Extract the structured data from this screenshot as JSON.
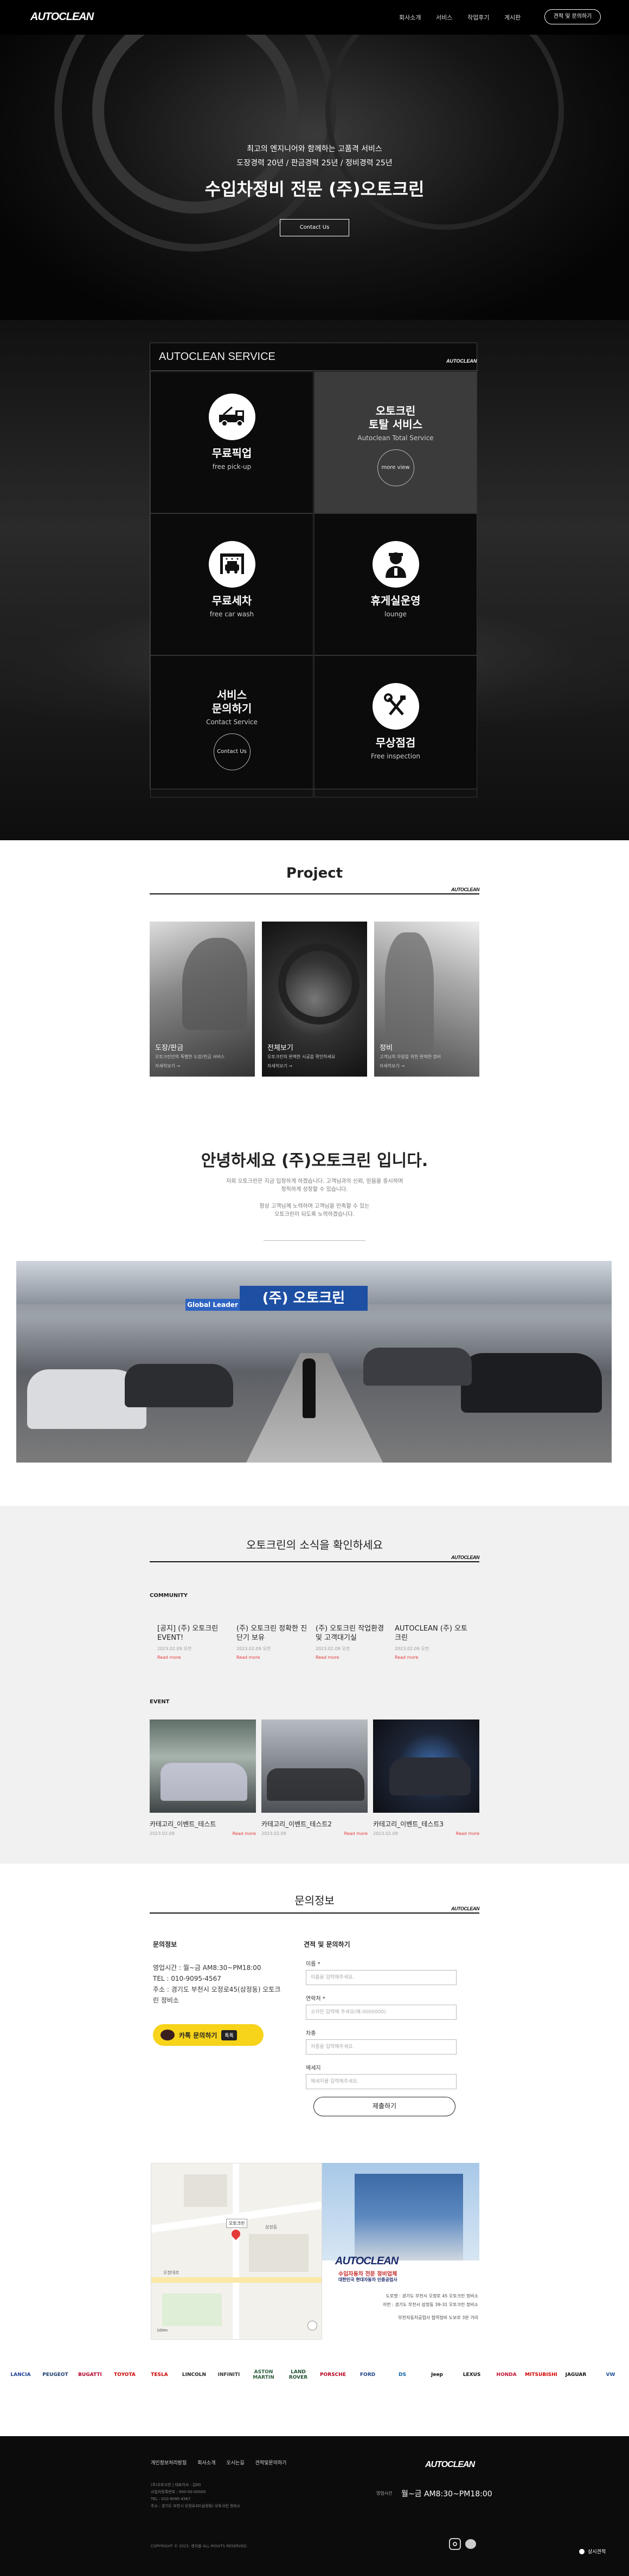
{
  "header": {
    "logo": "AUTOCLEAN",
    "nav": [
      "회사소개",
      "서비스",
      "작업후기",
      "게시판"
    ],
    "cta": "견적 및 문의하기"
  },
  "hero": {
    "line1": "최고의 엔지니어와 함께하는 고품격 서비스",
    "line2": "도장경력 20년 / 판금경력 25년 / 정비경력 25년",
    "title": "수입차정비 전문 (주)오토크린",
    "button": "Contact Us"
  },
  "services": {
    "title": "AUTOCLEAN SERVICE",
    "logo": "AUTOCLEAN",
    "cells": [
      {
        "title": "무료픽업",
        "sub": "free pick-up",
        "icon": "tow-truck-icon"
      },
      {
        "title_line1": "오토크린",
        "title_line2": "토탈 서비스",
        "sub": "Autoclean Total Service",
        "button": "more view"
      },
      {
        "title": "무료세차",
        "sub": "free car wash",
        "icon": "car-wash-icon"
      },
      {
        "title": "휴게실운영",
        "sub": "lounge",
        "icon": "lounge-staff-icon"
      },
      {
        "title_line1": "서비스",
        "title_line2": "문의하기",
        "sub": "Contact Service",
        "button": "Contact Us"
      },
      {
        "title": "무상점검",
        "sub": "Free inspection",
        "icon": "tools-icon"
      }
    ]
  },
  "project": {
    "title": "Project",
    "logo": "AUTOCLEAN",
    "items": [
      {
        "title": "도장/판금",
        "desc": "오토크린만의 특별한 도장/판금 서비스",
        "more": "자세히보기 →"
      },
      {
        "title": "전체보기",
        "desc": "오토크린의 완벽한 시공을 확인하세요",
        "more": "자세히보기 →"
      },
      {
        "title": "정비",
        "desc": "고객님의 차량을 위한 완벽한 정비",
        "more": "자세히보기 →"
      }
    ]
  },
  "intro": {
    "title": "안녕하세요 (주)오토크린 입니다.",
    "p1a": "저희 오토크린은 지금 입장하게 하겠습니다. 고객님과의 신뢰, 믿음을 중시하며",
    "p1b": "정직하게 성장할 수 있습니다.",
    "p2a": "항상 고객님께 노력하며 고객님을 만족할 수 있는",
    "p2b": "오토크린이 되도록 노력하겠습니다.",
    "sign_top": "(주) 오토크린",
    "sign_sub": "Global Leader"
  },
  "news": {
    "title": "오토크린의 소식을 확인하세요",
    "logo": "AUTOCLEAN",
    "community_label": "COMMUNITY",
    "community": [
      {
        "title": "[공지] (주) 오토크린 EVENT!",
        "date": "2023.02.09 오전",
        "more": "Read more"
      },
      {
        "title": "(주) 오토크린 정확한 진단기 보유",
        "date": "2023.02.09 오전",
        "more": "Read more"
      },
      {
        "title": "(주) 오토크린 작업환경 및 고객대기실",
        "date": "2023.02.09 오전",
        "more": "Read more"
      },
      {
        "title": "AUTOCLEAN (주) 오토크린",
        "date": "2023.02.09 오전",
        "more": "Read more"
      }
    ],
    "event_label": "EVENT",
    "events": [
      {
        "title": "카테고리_이벤트_테스트",
        "date": "2023.02.09",
        "more": "Read more"
      },
      {
        "title": "카테고리_이벤트_테스트2",
        "date": "2023.02.09",
        "more": "Read more"
      },
      {
        "title": "카테고리_이벤트_테스트3",
        "date": "2023.02.09",
        "more": "Read more"
      }
    ]
  },
  "contact": {
    "title": "문의정보",
    "logo": "AUTOCLEAN",
    "left_title": "문의정보",
    "hours": "영업시간 : 월~금 AM8:30~PM18:00",
    "phone": "TEL : 010-9095-4567",
    "address": "주소 : 경기도 부천시 오정로45(삼정동) 오토크린 정비소",
    "kakao": "카톡 문의하기",
    "kakao_badge": "톡톡",
    "form_title": "견적 및 문의하기",
    "fields": [
      {
        "label": "이름 *",
        "placeholder": "이름을 입력해주세요."
      },
      {
        "label": "연락처 *",
        "placeholder": "숫자만 입력해 주세요(예:0000000)"
      },
      {
        "label": "차종",
        "placeholder": "차종을 입력해주세요."
      },
      {
        "label": "메세지",
        "placeholder": "메세지를 입력해주세요."
      }
    ],
    "submit": "제출하기"
  },
  "map": {
    "marker": "오토크린",
    "label1": "오정대로",
    "label2": "삼정동",
    "scale": "100m"
  },
  "building": {
    "sign": "AUTOCLEAN",
    "sign_sub": "수입자동차 전문 정비업체",
    "sign_sub2": "대한민국 현대자동차 인증공업사",
    "addr1": "도로명 : 경기도 부천시 오정로 45 오토크린 정비소",
    "addr2": "지번 : 경기도 부천시 삼정동 39-31 오토크린 정비소",
    "addr3": "부천자동차공업사 협력정비 도보로 3분 거리"
  },
  "brands": [
    "LANCIA",
    "PEUGEOT",
    "BUGATTI",
    "TOYOTA",
    "TESLA",
    "LINCOLN",
    "INFINITI",
    "ASTON MARTIN",
    "LAND ROVER",
    "PORSCHE",
    "FORD",
    "DS",
    "Jeep",
    "LEXUS",
    "HONDA",
    "MITSUBISHI",
    "JAGUAR",
    "VW"
  ],
  "footer": {
    "links": [
      "개인정보처리방침",
      "회사소개",
      "오시는길",
      "견적및문의하기"
    ],
    "info": [
      "(주)오토크린 | 대표이사 : 김00",
      "사업자등록번호 : 000-00-00000",
      "TEL : 010-9095-4567",
      "주소 : 경기도 부천시 오정로45(삼정동) 오토크린 정비소"
    ],
    "logo": "AUTOCLEAN",
    "hours_label": "영업시간",
    "hours": "월~금 AM8:30~PM18:00",
    "copyright": "COPYRIGHT © 2023. 벤처몰 ALL RIGHTS RESERVED.",
    "chat": "상시견적",
    "accent": "#e53a3a"
  }
}
